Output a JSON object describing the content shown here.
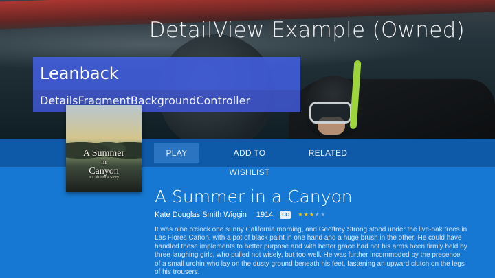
{
  "header": {
    "page_title": "DetailView Example (Owned)",
    "brand_title": "Leanback",
    "brand_subtitle": "DetailsFragmentBackgroundController"
  },
  "cover": {
    "title_line1": "A Summer",
    "title_line2": "in",
    "title_line3": "Canyon",
    "subtitle": "A California Story"
  },
  "actions": [
    {
      "label": "PLAY",
      "selected": true
    },
    {
      "label": "ADD TO WISHLIST",
      "selected": false
    },
    {
      "label": "RELATED",
      "selected": false
    }
  ],
  "details": {
    "title": "A Summer in a Canyon",
    "author": "Kate Douglas Smith Wiggin",
    "year": "1914",
    "cc_badge": "CC",
    "rating": 3,
    "rating_max": 5,
    "description": "It was nine o'clock one sunny California morning, and Geoffrey Strong stood under the live-oak trees in Las Flores Cañon, with a pot of black paint in one hand and a huge brush in the other. He could have handled these implements to better purpose and with better grace had not his arms been firmly held by three laughing girls, who pulled not wisely, but too well.  He was further incommoded by the presence of a small urchin who lay on the dusty ground beneath his feet, fastening an upward clutch on the legs of his trousers."
  },
  "colors": {
    "actions_bar": "#0f5aa8",
    "details_panel": "#1678d2",
    "header_box": "#425ee0",
    "star_filled": "#f5c518"
  }
}
